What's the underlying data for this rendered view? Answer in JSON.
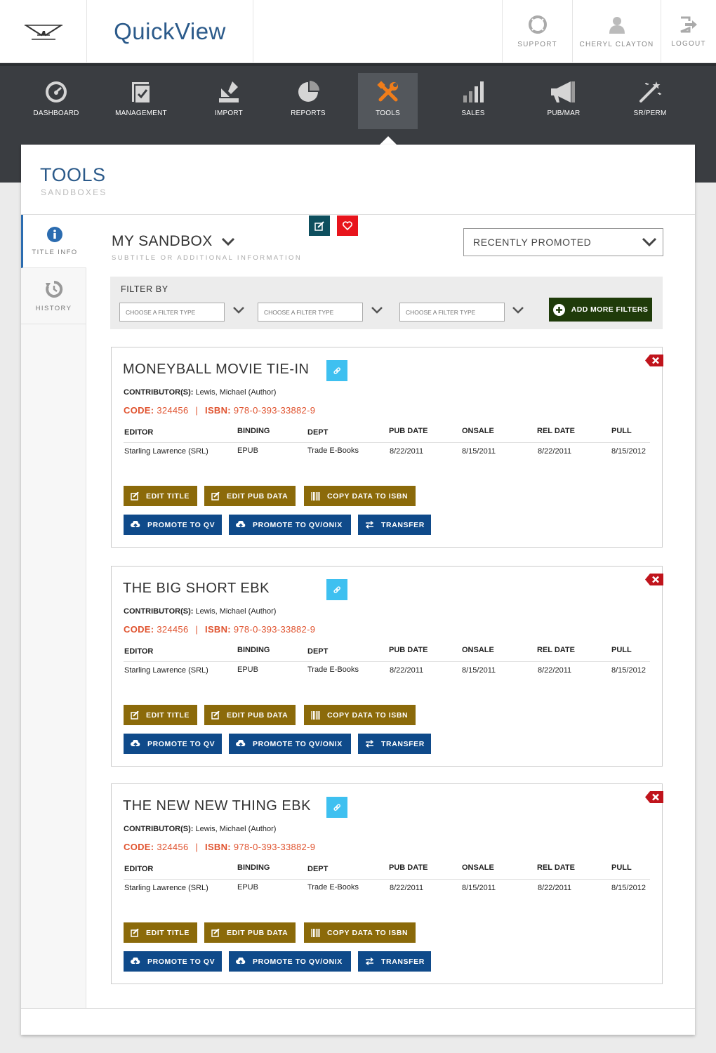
{
  "header": {
    "app_title": "QuickView",
    "support_label": "SUPPORT",
    "user_label": "CHERYL CLAYTON",
    "logout_label": "LOGOUT"
  },
  "nav": {
    "items": [
      {
        "label": "DASHBOARD",
        "icon": "dashboard-icon"
      },
      {
        "label": "MANAGEMENT",
        "icon": "management-icon"
      },
      {
        "label": "IMPORT",
        "icon": "import-icon"
      },
      {
        "label": "REPORTS",
        "icon": "reports-icon"
      },
      {
        "label": "TOOLS",
        "icon": "tools-icon",
        "active": true
      },
      {
        "label": "SALES",
        "icon": "sales-icon"
      },
      {
        "label": "PUB/MAR",
        "icon": "megaphone-icon"
      },
      {
        "label": "SR/PERM",
        "icon": "magic-wand-icon"
      }
    ]
  },
  "page": {
    "title": "TOOLS",
    "subtitle": "SANDBOXES"
  },
  "sidebar": {
    "items": [
      {
        "label": "TITLE INFO",
        "icon": "info-icon",
        "active": true
      },
      {
        "label": "HISTORY",
        "icon": "history-icon"
      }
    ]
  },
  "sandbox": {
    "title": "MY SANDBOX",
    "subtitle": "SUBTITLE OR ADDITIONAL INFORMATION",
    "sort_value": "RECENTLY PROMOTED"
  },
  "filters": {
    "label": "FILTER BY",
    "placeholder": "CHOOSE A FILTER TYPE",
    "add_label": "ADD MORE FILTERS"
  },
  "columns": [
    "EDITOR",
    "BINDING",
    "DEPT",
    "PUB DATE",
    "ONSALE",
    "REL DATE",
    "PULL"
  ],
  "labels": {
    "contributors": "CONTRIBUTOR(S):",
    "code": "CODE:",
    "isbn": "ISBN:",
    "separator": "|"
  },
  "actions": {
    "edit_title": "EDIT TITLE",
    "edit_pub_data": "EDIT PUB DATA",
    "copy_data": "COPY DATA TO ISBN",
    "promote_qv": "PROMOTE TO QV",
    "promote_onix": "PROMOTE TO QV/ONIX",
    "transfer": "TRANSFER"
  },
  "cards": [
    {
      "title": "MONEYBALL MOVIE TIE-IN",
      "contributors": "Lewis, Michael (Author)",
      "code": "324456",
      "isbn": "978-0-393-33882-9",
      "row": [
        "Starling Lawrence (SRL)",
        "EPUB",
        "Trade E-Books",
        "8/22/2011",
        "8/15/2011",
        "8/22/2011",
        "8/15/2012"
      ]
    },
    {
      "title": "THE BIG SHORT EBK",
      "contributors": "Lewis, Michael (Author)",
      "code": "324456",
      "isbn": "978-0-393-33882-9",
      "row": [
        "Starling Lawrence (SRL)",
        "EPUB",
        "Trade E-Books",
        "8/22/2011",
        "8/15/2011",
        "8/22/2011",
        "8/15/2012"
      ]
    },
    {
      "title": "THE NEW NEW THING EBK",
      "contributors": "Lewis, Michael (Author)",
      "code": "324456",
      "isbn": "978-0-393-33882-9",
      "row": [
        "Starling Lawrence (SRL)",
        "EPUB",
        "Trade E-Books",
        "8/22/2011",
        "8/15/2011",
        "8/22/2011",
        "8/15/2012"
      ]
    }
  ],
  "colors": {
    "brand_blue": "#2b5a8a",
    "nav_bg": "#3a3d41",
    "tools_accent": "#f07d1a",
    "gold_button": "#8b6a0a",
    "blue_button": "#0f4a8a",
    "add_filter": "#1f3b0a",
    "code_text": "#e0532f",
    "link_button": "#3ec0f0",
    "close_button": "#c0141c"
  }
}
